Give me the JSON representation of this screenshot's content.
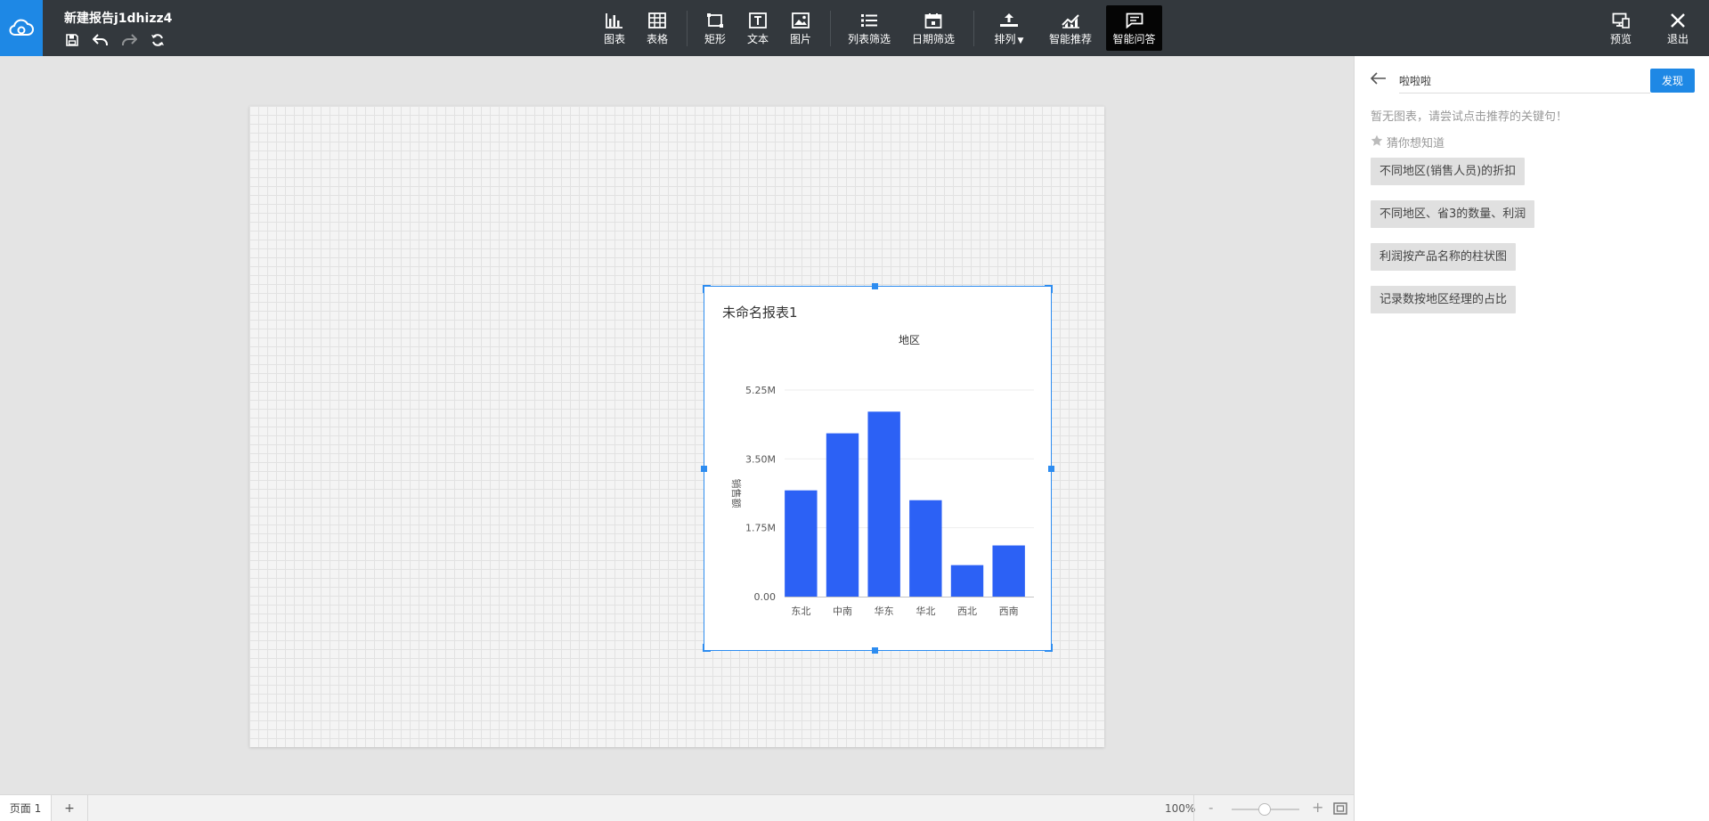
{
  "app": {
    "doc_title": "新建报告j1dhizz4"
  },
  "icons": {
    "logo": "cloud-logo-icon",
    "save": "save-icon",
    "undo": "undo-icon",
    "redo": "redo-icon",
    "refresh": "refresh-icon"
  },
  "toolbar": {
    "chart": "图表",
    "table": "表格",
    "rect": "矩形",
    "text": "文本",
    "image": "图片",
    "list_filter": "列表筛选",
    "date_filter": "日期筛选",
    "arrange": "排列",
    "smart_recommend": "智能推荐",
    "smart_qa": "智能问答",
    "preview": "预览",
    "exit": "退出"
  },
  "colors": {
    "topbar": "#33383d",
    "accent": "#1e88e5",
    "bar": "#2c61f5",
    "selection": "#2d8cf0"
  },
  "widget": {
    "title": "未命名报表1"
  },
  "chart_data": {
    "type": "bar",
    "title": "地区",
    "xlabel": "",
    "ylabel": "销售额",
    "categories": [
      "东北",
      "中南",
      "华东",
      "华北",
      "西北",
      "西南"
    ],
    "values": [
      2700000,
      4150000,
      4700000,
      2450000,
      800000,
      1300000
    ],
    "yticks": [
      "0.00",
      "1.75M",
      "3.50M",
      "5.25M"
    ],
    "ylim": [
      0,
      5250000
    ],
    "grid": true,
    "legend": "none"
  },
  "panel": {
    "query_value": "啦啦啦",
    "send_label": "发现",
    "no_chart_msg": "暂无图表，请尝试点击推荐的关键句！",
    "guess_label": "猜你想知道",
    "suggestions": [
      "不同地区(销售人员)的折扣",
      "不同地区、省3的数量、利润",
      "利润按产品名称的柱状图",
      "记录数按地区经理的占比"
    ]
  },
  "status": {
    "page_tab": "页面 1",
    "add_page": "+",
    "zoom": "100%",
    "zoom_minus": "-",
    "zoom_plus": "+"
  }
}
